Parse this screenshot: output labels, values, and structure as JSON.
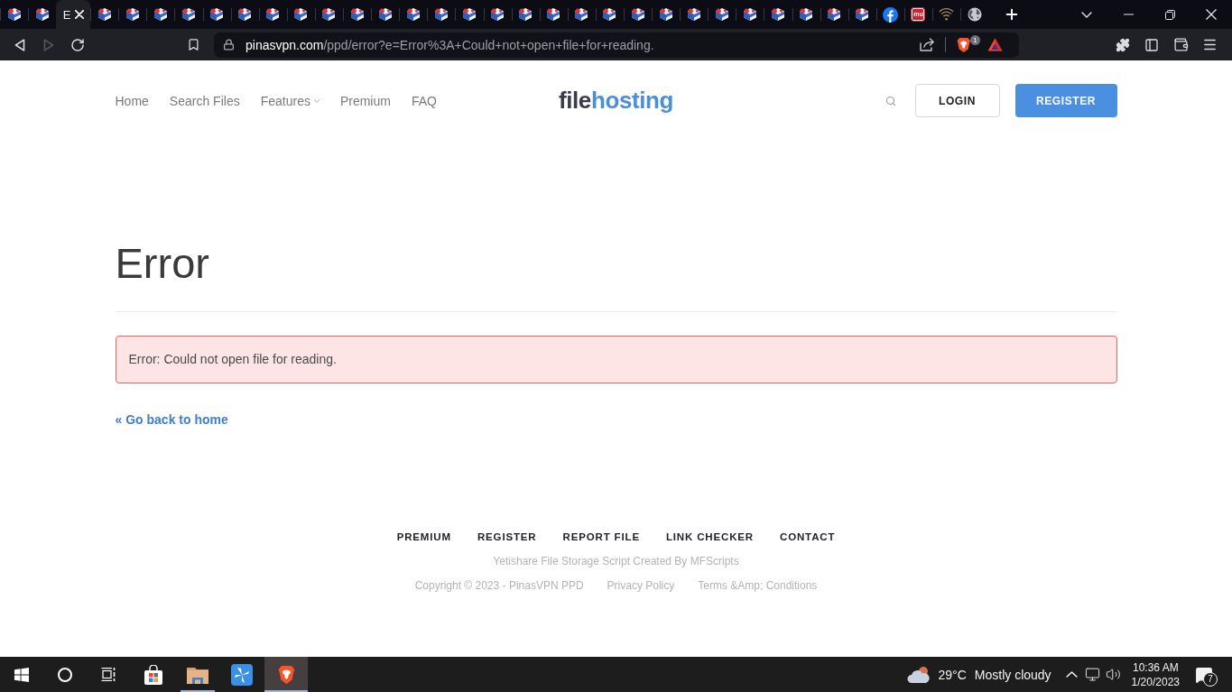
{
  "browser": {
    "tabs": [
      {
        "kind": "cube",
        "selected": false
      },
      {
        "kind": "cube",
        "selected": false
      },
      {
        "kind": "blank",
        "title": "E",
        "selected": true
      },
      {
        "kind": "cube",
        "selected": false
      },
      {
        "kind": "cube",
        "selected": false
      },
      {
        "kind": "cube",
        "selected": false
      },
      {
        "kind": "cube",
        "selected": false
      },
      {
        "kind": "cube",
        "selected": false
      },
      {
        "kind": "cube",
        "selected": false
      },
      {
        "kind": "cube",
        "selected": false
      },
      {
        "kind": "cube",
        "selected": false
      },
      {
        "kind": "cube",
        "selected": false
      },
      {
        "kind": "cube",
        "selected": false
      },
      {
        "kind": "cube",
        "selected": false
      },
      {
        "kind": "cube",
        "selected": false
      },
      {
        "kind": "cube",
        "selected": false
      },
      {
        "kind": "cube",
        "selected": false
      },
      {
        "kind": "cube",
        "selected": false
      },
      {
        "kind": "cube",
        "selected": false
      },
      {
        "kind": "cube",
        "selected": false
      },
      {
        "kind": "cube",
        "selected": false
      },
      {
        "kind": "cube",
        "selected": false
      },
      {
        "kind": "cube",
        "selected": false
      },
      {
        "kind": "cube",
        "selected": false
      },
      {
        "kind": "cube",
        "selected": false
      },
      {
        "kind": "cube",
        "selected": false
      },
      {
        "kind": "cube",
        "selected": false
      },
      {
        "kind": "cube",
        "selected": false
      },
      {
        "kind": "cube",
        "selected": false
      },
      {
        "kind": "cube",
        "selected": false
      },
      {
        "kind": "cube",
        "selected": false
      },
      {
        "kind": "round_logo",
        "selected": false
      },
      {
        "kind": "tile_logo",
        "icon_text": "mu",
        "selected": false
      },
      {
        "kind": "signal",
        "selected": false
      },
      {
        "kind": "globe",
        "selected": false
      }
    ],
    "nav_buttons": [
      {
        "kind": "back",
        "disabled": false
      },
      {
        "kind": "forward",
        "disabled": true
      },
      {
        "kind": "reload",
        "disabled": false
      }
    ],
    "address": {
      "host": "pinasvpn.com",
      "path": "/ppd/error?e=Error%3A+Could+not+open+file+for+reading."
    },
    "shields_badge": "1"
  },
  "site": {
    "nav": [
      {
        "label": "Home",
        "has_menu": false
      },
      {
        "label": "Search Files",
        "has_menu": false
      },
      {
        "label": "Features",
        "has_menu": true
      },
      {
        "label": "Premium",
        "has_menu": false
      },
      {
        "label": "FAQ",
        "has_menu": false
      }
    ],
    "logo": {
      "first": "file",
      "second": "hosting"
    },
    "login": "LOGIN",
    "register": "REGISTER"
  },
  "content": {
    "title": "Error",
    "alert": "Error: Could not open file for reading.",
    "back_link": "« Go back to home"
  },
  "footer": {
    "links": [
      "PREMIUM",
      "REGISTER",
      "REPORT FILE",
      "LINK CHECKER",
      "CONTACT"
    ],
    "credit": "Yetishare File Storage Script Created By MFScripts",
    "copyright": "Copyright © 2023 - PinasVPN PPD",
    "legal_links": [
      "Privacy Policy",
      "Terms &Amp; Conditions"
    ]
  },
  "taskbar": {
    "apps": [
      {
        "kind": "store",
        "running": false,
        "selected": false
      },
      {
        "kind": "folder",
        "running": true,
        "selected": false
      },
      {
        "kind": "pinwheel",
        "running": false,
        "selected": false
      },
      {
        "kind": "brave",
        "running": true,
        "selected": true
      }
    ],
    "weather": {
      "temperature": "29°C",
      "summary": "Mostly cloudy"
    },
    "clock": {
      "time": "10:36 AM",
      "date": "1/20/2023"
    },
    "notifications": "7"
  }
}
